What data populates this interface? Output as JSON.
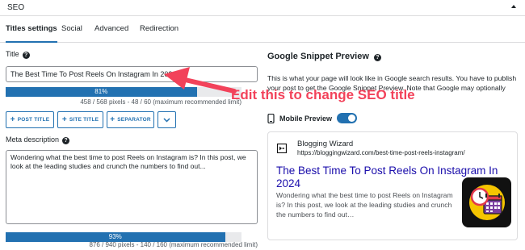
{
  "panel": {
    "title": "SEO"
  },
  "tabs": [
    {
      "label": "Titles settings",
      "active": true
    },
    {
      "label": "Social",
      "active": false
    },
    {
      "label": "Advanced",
      "active": false
    },
    {
      "label": "Redirection",
      "active": false
    }
  ],
  "title_field": {
    "label": "Title",
    "value": "The Best Time To Post Reels On Instagram In 2024",
    "progress_percent": 81,
    "progress_label": "81%",
    "info": "458 / 568 pixels - 48 / 60 (maximum recommended limit)"
  },
  "variable_buttons": [
    {
      "label": "POST TITLE"
    },
    {
      "label": "SITE TITLE"
    },
    {
      "label": "SEPARATOR"
    }
  ],
  "meta_field": {
    "label": "Meta description",
    "value": "Wondering what the best time to post Reels on Instagram is? In this post, we look at the leading studies and crunch the numbers to find out...",
    "progress_percent": 93,
    "progress_label": "93%",
    "info": "876 / 940 pixels - 140 / 160 (maximum recommended limit)"
  },
  "annotation": {
    "text": "Edit this to change SEO title",
    "color": "#f2425a"
  },
  "snippet_preview": {
    "heading": "Google Snippet Preview",
    "description": "This is what your page will look like in Google search results. You have to publish your post to get the Google Snippet Preview. Note that Google may optionally",
    "mobile_preview_label": "Mobile Preview",
    "mobile_preview_on": true,
    "site_name": "Blogging Wizard",
    "site_url": "https://bloggingwizard.com/best-time-post-reels-instagram/",
    "result_title": "The Best Time To Post Reels On Instagram In 2024",
    "result_description": "Wondering what the best time to post Reels on Instagram is? In this post, we look at the leading studies and crunch the numbers to find out…"
  },
  "colors": {
    "accent": "#2271b1",
    "link": "#1a0dab",
    "annotation": "#f2425a"
  }
}
